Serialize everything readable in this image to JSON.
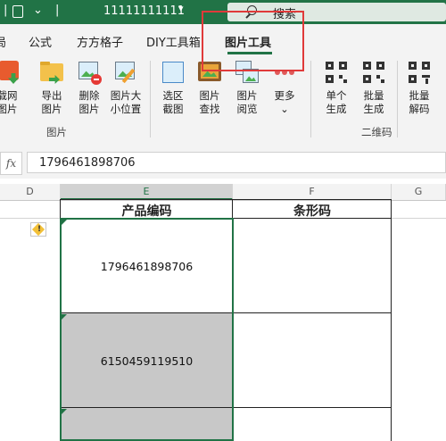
{
  "titlebar": {
    "file_name": "11111111111",
    "search_placeholder": "搜索"
  },
  "tabs": [
    {
      "label": "局"
    },
    {
      "label": "公式"
    },
    {
      "label": "方方格子"
    },
    {
      "label": "DIY工具箱"
    },
    {
      "label": "图片工具"
    }
  ],
  "ribbon": {
    "picture_buttons": [
      {
        "label1": "载网",
        "label2": "图片"
      },
      {
        "label1": "导出",
        "label2": "图片"
      },
      {
        "label1": "删除",
        "label2": "图片"
      },
      {
        "label1": "图片大",
        "label2": "小位置"
      },
      {
        "label1": "选区",
        "label2": "截图"
      },
      {
        "label1": "图片",
        "label2": "查找"
      },
      {
        "label1": "图片",
        "label2": "阅览"
      },
      {
        "label1": "更多",
        "label2": "⌄"
      }
    ],
    "qr_buttons": [
      {
        "label1": "单个",
        "label2": "生成"
      },
      {
        "label1": "批量",
        "label2": "生成"
      },
      {
        "label1": "批量",
        "label2": "解码"
      }
    ],
    "group_picture": "图片",
    "group_qr": "二维码"
  },
  "formula_bar": {
    "fx": "fx",
    "value": "1796461898706"
  },
  "grid": {
    "columns": [
      "D",
      "E",
      "F",
      "G"
    ],
    "header_e": "产品编码",
    "header_f": "条形码",
    "codes": [
      "1796461898706",
      "6150459119510"
    ]
  },
  "colors": {
    "accent": "#217346",
    "highlight": "#e03a3a",
    "selected_fill": "#c8c8c8"
  }
}
